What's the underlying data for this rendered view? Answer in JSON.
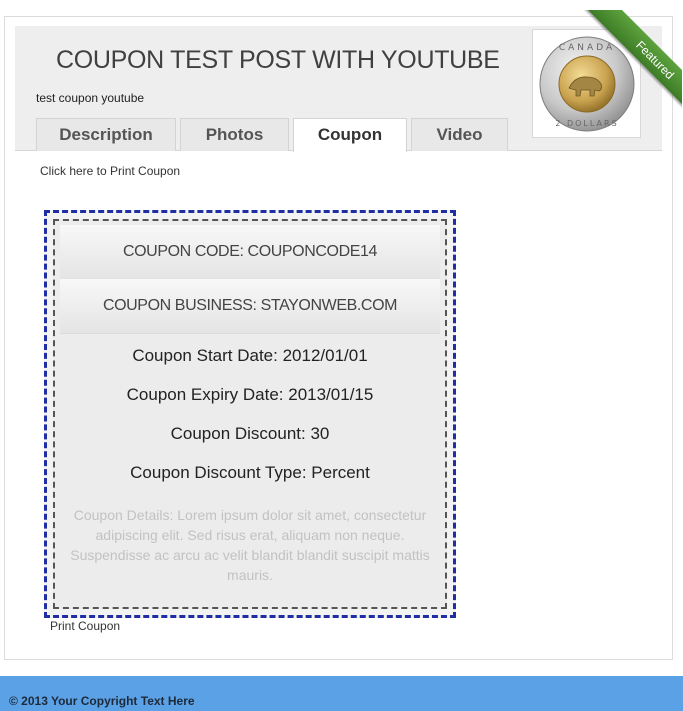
{
  "post": {
    "title": "COUPON TEST POST WITH YOUTUBE",
    "subtitle": "test coupon youtube"
  },
  "tabs": [
    {
      "label": "Description",
      "active": false
    },
    {
      "label": "Photos",
      "active": false
    },
    {
      "label": "Coupon",
      "active": true
    },
    {
      "label": "Video",
      "active": false
    }
  ],
  "badge": {
    "label": "Featured",
    "color": "#4a8d2e"
  },
  "coin": {
    "top_text": "CANADA",
    "bottom_text": "2 DOLLARS"
  },
  "print_link_top": "Click here to Print Coupon",
  "coupon": {
    "code": "COUPON CODE: COUPONCODE14",
    "business": "COUPON BUSINESS: STAYONWEB.COM",
    "start_date": "Coupon Start Date: 2012/01/01",
    "expiry_date": "Coupon Expiry Date: 2013/01/15",
    "discount": "Coupon Discount: 30",
    "discount_type": "Coupon Discount Type: Percent",
    "details": "Coupon Details: Lorem ipsum dolor sit amet, consectetur adipiscing elit. Sed risus erat, aliquam non neque. Suspendisse ac arcu ac velit blandit blandit suscipit mattis mauris."
  },
  "print_link_bottom": "Print Coupon",
  "footer": {
    "copyright": "© 2013 Your Copyright Text Here",
    "color": "#5ba1e6"
  }
}
